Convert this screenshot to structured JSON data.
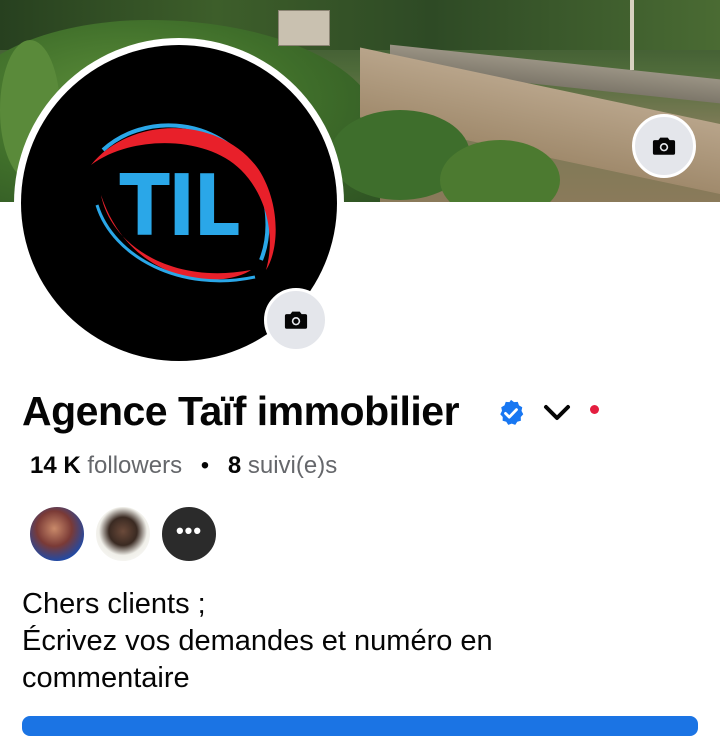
{
  "profile": {
    "name": "Agence Taïf immobilier",
    "logo_text": "TIL",
    "followers_count": "14 K",
    "followers_label": "followers",
    "separator": "•",
    "following_count": "8",
    "following_label": "suivi(e)s"
  },
  "bio": {
    "lines": [
      "Chers clients ;",
      "Écrivez vos demandes et numéro en",
      "commentaire"
    ]
  },
  "mutual_friends": {
    "more_glyph": "•••"
  },
  "icons": {
    "cover_camera": "camera-icon",
    "avatar_camera": "camera-icon",
    "verified": "verified-badge-icon",
    "dropdown": "chevron-down-icon"
  },
  "colors": {
    "verified_blue": "#1877f2",
    "notification_red": "#e41e3f",
    "logo_blue": "#2aa7e8",
    "logo_red": "#e8202a",
    "primary_button": "#1b74e4"
  }
}
